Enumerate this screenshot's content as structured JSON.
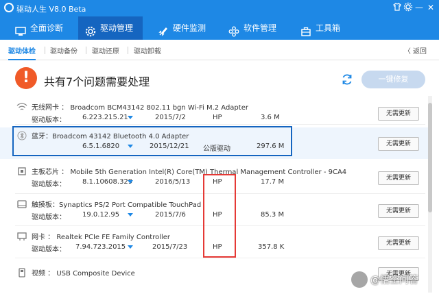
{
  "app": {
    "title": "驱动人生 V8.0 Beta"
  },
  "window_controls": {
    "skin_icon": "skin-icon",
    "settings_icon": "gear-icon",
    "minimize": "—",
    "close": "✕"
  },
  "nav": [
    {
      "label": "全面诊断",
      "icon": "monitor-icon"
    },
    {
      "label": "驱动管理",
      "icon": "gear-icon"
    },
    {
      "label": "硬件监测",
      "icon": "rocket-icon"
    },
    {
      "label": "软件管理",
      "icon": "apps-icon"
    },
    {
      "label": "工具箱",
      "icon": "toolbox-icon"
    }
  ],
  "subtabs": [
    "驱动体检",
    "驱动备份",
    "驱动还原",
    "驱动卸载"
  ],
  "back": {
    "label": "返回"
  },
  "summary": {
    "title": "共有7个问题需要处理",
    "fix_button": "一键修复"
  },
  "rows": [
    {
      "category": "无线网卡",
      "name": "Broadcom BCM43142 802.11 bgn Wi-Fi M.2 Adapter",
      "version_label": "驱动版本：",
      "version": "6.223.215.21",
      "date": "2015/7/2",
      "vendor": "HP",
      "size": "3.6 M",
      "button": "无需更新"
    },
    {
      "category": "蓝牙",
      "name": "Broadcom 43142 Bluetooth 4.0 Adapter",
      "version_label": "",
      "version": "6.5.1.6820",
      "date": "2015/12/21",
      "vendor": "公版驱动",
      "size": "297.6 M",
      "button": "无需更新"
    },
    {
      "category": "主板芯片",
      "name": "Mobile 5th Generation Intel(R) Core(TM) Thermal Management Controller - 9CA4",
      "version_label": "驱动版本：",
      "version": "8.1.10608.329",
      "date": "2016/5/13",
      "vendor": "HP",
      "size": "17.7 M",
      "button": "无需更新"
    },
    {
      "category": "触摸板",
      "name": "Synaptics PS/2 Port Compatible TouchPad",
      "version_label": "驱动版本：",
      "version": "19.0.12.95",
      "date": "2015/7/6",
      "vendor": "HP",
      "size": "85.3 M",
      "button": "无需更新"
    },
    {
      "category": "网卡",
      "name": "Realtek PCIe FE Family Controller",
      "version_label": "驱动版本：",
      "version": "7.94.723.2015",
      "date": "2015/7/23",
      "vendor": "HP",
      "size": "357.8 K",
      "button": "无需更新"
    },
    {
      "category": "视频",
      "name": "USB Composite Device",
      "version_label": "",
      "version": "",
      "date": "",
      "vendor": "",
      "size": "",
      "button": "无需更新"
    }
  ],
  "watermark": {
    "text": "@悟空问答"
  }
}
